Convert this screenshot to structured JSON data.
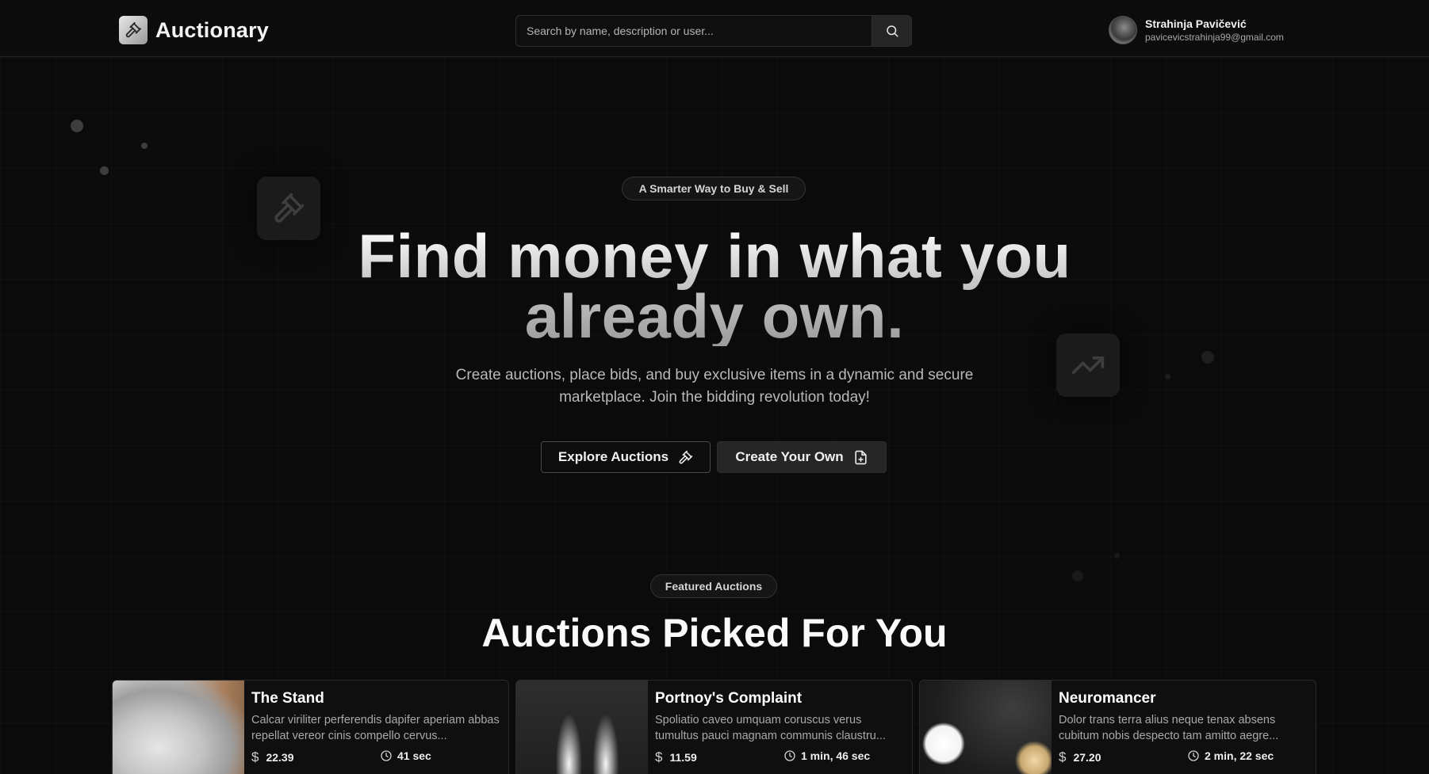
{
  "header": {
    "brand": "Auctionary",
    "search_placeholder": "Search by name, description or user...",
    "user": {
      "name": "Strahinja Pavičević",
      "email": "pavicevicstrahinja99@gmail.com"
    }
  },
  "hero": {
    "tagline": "A Smarter Way to Buy & Sell",
    "title_line1": "Find money in what you",
    "title_line2": "already own.",
    "subtitle": "Create auctions, place bids, and buy exclusive items in a dynamic and secure marketplace. Join the bidding revolution today!",
    "explore_button": "Explore Auctions",
    "create_button": "Create Your Own"
  },
  "featured": {
    "tag": "Featured Auctions",
    "title": "Auctions Picked For You",
    "cards": [
      {
        "title": "The Stand",
        "description": "Calcar viriliter perferendis dapifer aperiam abbas repellat vereor cinis compello cervus...",
        "price": "22.39",
        "time_left": "41 sec"
      },
      {
        "title": "Portnoy's Complaint",
        "description": "Spoliatio caveo umquam coruscus verus tumultus pauci magnam communis claustru...",
        "price": "11.59",
        "time_left": "1 min, 46 sec"
      },
      {
        "title": "Neuromancer",
        "description": "Dolor trans terra alius neque tenax absens cubitum nobis despecto tam amitto aegre...",
        "price": "27.20",
        "time_left": "2 min, 22 sec"
      }
    ]
  },
  "colors": {
    "background": "#0b0b0b",
    "text": "#f2f2f2",
    "muted": "#a9a9a9",
    "border": "#2a2a2a"
  },
  "icons": [
    "gavel-icon",
    "search-icon",
    "trending-up-icon",
    "file-plus-icon",
    "dollar-icon",
    "clock-icon"
  ]
}
